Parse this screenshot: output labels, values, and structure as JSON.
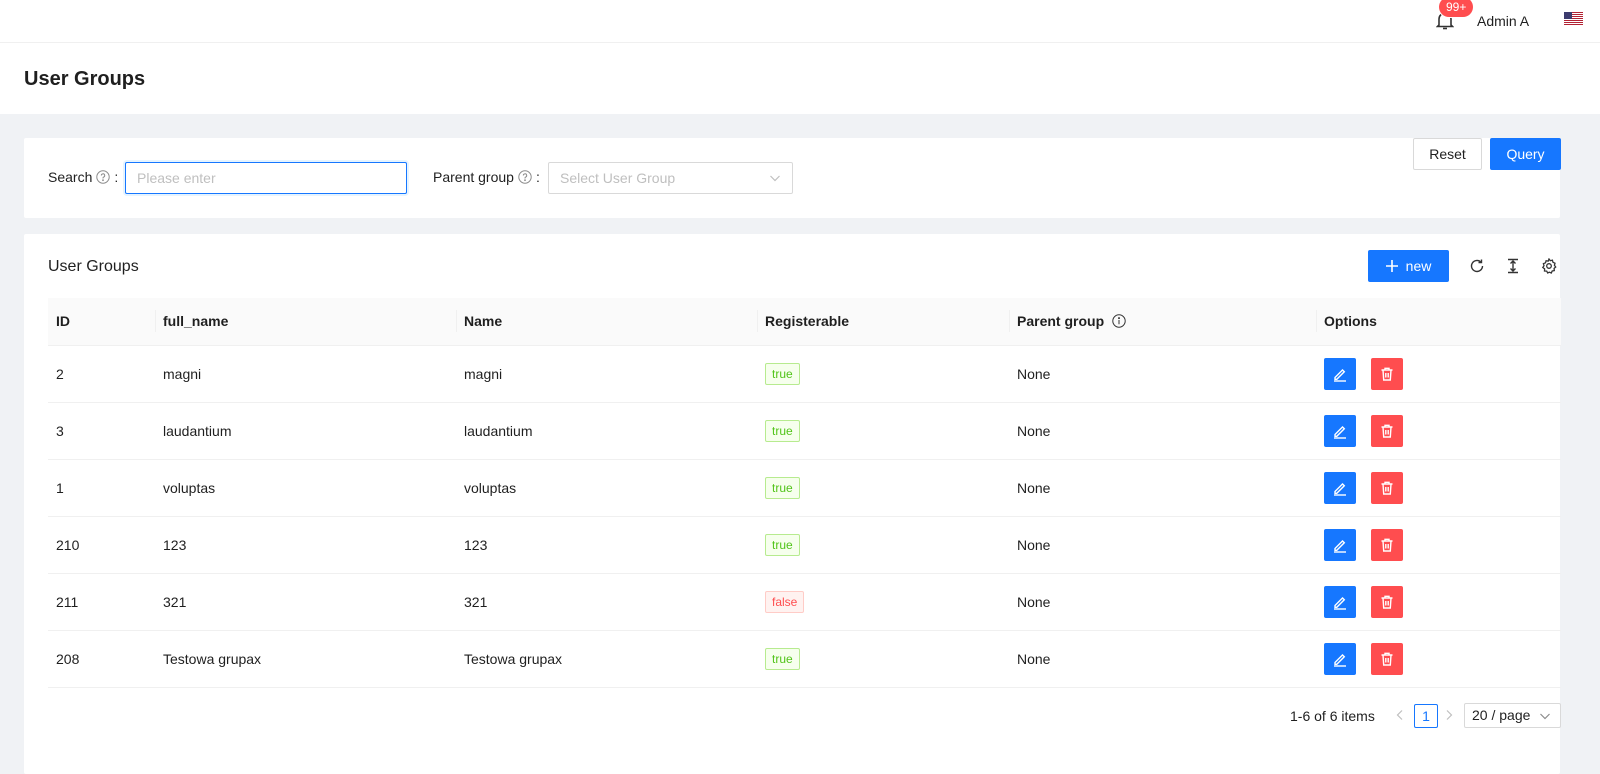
{
  "header": {
    "notification_badge": "99+",
    "user_name": "Admin A",
    "language_icon": "us-flag-icon"
  },
  "page": {
    "title": "User Groups"
  },
  "search": {
    "search_label": "Search",
    "search_placeholder": "Please enter",
    "parent_label": "Parent group",
    "parent_placeholder": "Select User Group",
    "colon": ":",
    "reset_label": "Reset",
    "query_label": "Query"
  },
  "table": {
    "title": "User Groups",
    "new_label": "new",
    "columns": [
      "ID",
      "full_name",
      "Name",
      "Registerable",
      "Parent group",
      "Options"
    ],
    "rows": [
      {
        "id": "2",
        "full_name": "magni",
        "name": "magni",
        "registerable": "true",
        "parent": "None"
      },
      {
        "id": "3",
        "full_name": "laudantium",
        "name": "laudantium",
        "registerable": "true",
        "parent": "None"
      },
      {
        "id": "1",
        "full_name": "voluptas",
        "name": "voluptas",
        "registerable": "true",
        "parent": "None"
      },
      {
        "id": "210",
        "full_name": "123",
        "name": "123",
        "registerable": "true",
        "parent": "None"
      },
      {
        "id": "211",
        "full_name": "321",
        "name": "321",
        "registerable": "false",
        "parent": "None"
      },
      {
        "id": "208",
        "full_name": "Testowa grupax",
        "name": "Testowa grupax",
        "registerable": "true",
        "parent": "None"
      }
    ]
  },
  "pagination": {
    "total_text": "1-6 of 6 items",
    "current_page": "1",
    "page_size": "20 / page"
  },
  "colors": {
    "primary": "#1677ff",
    "danger": "#ff4d4f",
    "success": "#52c41a"
  }
}
